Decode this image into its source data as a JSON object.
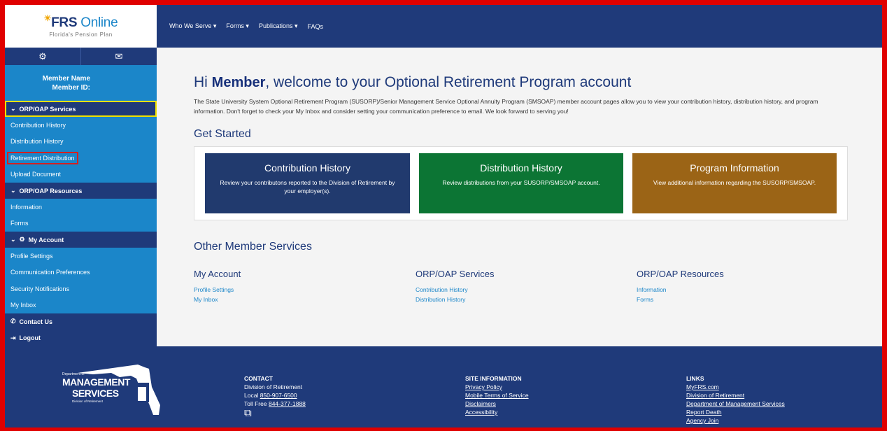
{
  "sidebar": {
    "logo_title_bold": "FRS",
    "logo_title_rest": "Online",
    "logo_subtitle": "Florida's Pension Plan",
    "member_name": "Member Name",
    "member_id": "Member ID:",
    "sections": [
      {
        "label": "ORP/OAP Services",
        "items": [
          "Contribution History",
          "Distribution History",
          "Retirement Distribution",
          "Upload Document"
        ]
      },
      {
        "label": "ORP/OAP Resources",
        "items": [
          "Information",
          "Forms"
        ]
      },
      {
        "label": "My Account",
        "items": [
          "Profile Settings",
          "Communication Preferences",
          "Security Notifications",
          "My Inbox"
        ]
      }
    ],
    "contact": "Contact Us",
    "logout": "Logout"
  },
  "topnav": [
    "Who We Serve",
    "Forms",
    "Publications",
    "FAQs"
  ],
  "main": {
    "welcome_pre": "Hi ",
    "welcome_name": "Member",
    "welcome_post": ", welcome to your Optional Retirement Program account",
    "intro": "The State University System Optional Retirement Program (SUSORP)/Senior Management Service Optional Annuity Program (SMSOAP) member account pages allow you to view your contribution history, distribution history, and program information. Don't forget to check your My Inbox and consider setting your communication preference to email. We look forward to serving you!",
    "get_started": "Get Started",
    "cards": [
      {
        "title": "Contribution History",
        "desc": "Review your contributons reported to the Division of Retirement by your employer(s).",
        "color": "#213a6e"
      },
      {
        "title": "Distribution History",
        "desc": "Review distributions from your SUSORP/SMSOAP account.",
        "color": "#0c7534"
      },
      {
        "title": "Program Information",
        "desc": "View additional information regarding the SUSORP/SMSOAP.",
        "color": "#9b6416"
      }
    ],
    "other_services": "Other Member Services",
    "columns": [
      {
        "title": "My Account",
        "links": [
          "Profile Settings",
          "My Inbox"
        ]
      },
      {
        "title": "ORP/OAP Services",
        "links": [
          "Contribution History",
          "Distribution History"
        ]
      },
      {
        "title": "ORP/OAP Resources",
        "links": [
          "Information",
          "Forms"
        ]
      }
    ]
  },
  "footer": {
    "dms_line1": "Department of",
    "dms_line2": "MANAGEMENT",
    "dms_line3": "SERVICES",
    "dms_line4": "Division of Retirement",
    "contact_title": "CONTACT",
    "contact_org": "Division of Retirement",
    "contact_local_label": "Local ",
    "contact_local": "850-907-6500",
    "contact_tollfree_label": "Toll Free ",
    "contact_tollfree": "844-377-1888",
    "site_title": "SITE INFORMATION",
    "site_links": [
      "Privacy Policy",
      "Mobile Terms of Service",
      "Disclaimers",
      "Accessibility"
    ],
    "links_title": "LINKS",
    "links": [
      "MyFRS.com",
      "Division of Retirement",
      "Department of Management Services",
      "Report Death",
      "Agency Join"
    ]
  },
  "colors": {
    "navy": "#1f3a7a",
    "sidebar_blue": "#1b86c9",
    "highlight_yellow": "#f0e000",
    "highlight_red": "#d42020",
    "frame_red": "#e00000"
  }
}
